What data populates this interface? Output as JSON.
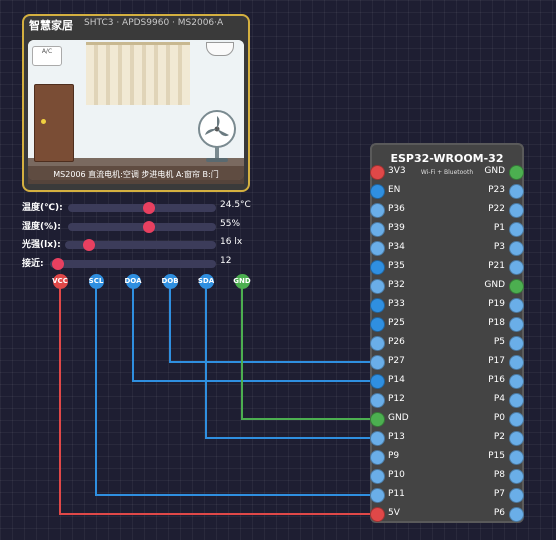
{
  "home_module": {
    "title": "智慧家居",
    "subtitle": "SHTC3 · APDS9960 · MS2006·A",
    "ac_label": "A/C",
    "status_text": "MS2006 直流电机:空调 步进电机 A:窗帘 B:门"
  },
  "sliders": [
    {
      "label": "温度(℃):",
      "value_text": "24.5°C",
      "fraction": 0.55
    },
    {
      "label": "湿度(%):",
      "value_text": "55%",
      "fraction": 0.55
    },
    {
      "label": "光强(lx):",
      "value_text": "16 lx",
      "fraction": 0.16
    },
    {
      "label": "接近:",
      "value_text": "12",
      "fraction": 0.05
    }
  ],
  "module_pins": [
    {
      "label": "VCC",
      "color": "#e04848"
    },
    {
      "label": "SCL",
      "color": "#2f8fe0"
    },
    {
      "label": "DOA",
      "color": "#2f8fe0"
    },
    {
      "label": "DOB",
      "color": "#2f8fe0"
    },
    {
      "label": "SDA",
      "color": "#2f8fe0"
    },
    {
      "label": "GND",
      "color": "#4caf50"
    }
  ],
  "esp32": {
    "title": "ESP32-WROOM-32",
    "subtitle": "Wi-Fi + Bluetooth",
    "left_pins": [
      {
        "label": "3V3",
        "color": "#e04848"
      },
      {
        "label": "EN",
        "color": "#2f8fe0"
      },
      {
        "label": "P36",
        "color": "#6aaee8"
      },
      {
        "label": "P39",
        "color": "#6aaee8"
      },
      {
        "label": "P34",
        "color": "#6aaee8"
      },
      {
        "label": "P35",
        "color": "#2f8fe0"
      },
      {
        "label": "P32",
        "color": "#6aaee8"
      },
      {
        "label": "P33",
        "color": "#2f8fe0"
      },
      {
        "label": "P25",
        "color": "#2f8fe0"
      },
      {
        "label": "P26",
        "color": "#6aaee8"
      },
      {
        "label": "P27",
        "color": "#6aaee8"
      },
      {
        "label": "P14",
        "color": "#2f8fe0"
      },
      {
        "label": "P12",
        "color": "#6aaee8"
      },
      {
        "label": "GND",
        "color": "#4caf50"
      },
      {
        "label": "P13",
        "color": "#6aaee8"
      },
      {
        "label": "P9",
        "color": "#6aaee8"
      },
      {
        "label": "P10",
        "color": "#6aaee8"
      },
      {
        "label": "P11",
        "color": "#6aaee8"
      },
      {
        "label": "5V",
        "color": "#e04848"
      }
    ],
    "right_pins": [
      {
        "label": "GND",
        "color": "#4caf50"
      },
      {
        "label": "P23",
        "color": "#6aaee8"
      },
      {
        "label": "P22",
        "color": "#6aaee8"
      },
      {
        "label": "P1",
        "color": "#6aaee8"
      },
      {
        "label": "P3",
        "color": "#6aaee8"
      },
      {
        "label": "P21",
        "color": "#6aaee8"
      },
      {
        "label": "GND",
        "color": "#4caf50"
      },
      {
        "label": "P19",
        "color": "#6aaee8"
      },
      {
        "label": "P18",
        "color": "#6aaee8"
      },
      {
        "label": "P5",
        "color": "#6aaee8"
      },
      {
        "label": "P17",
        "color": "#6aaee8"
      },
      {
        "label": "P16",
        "color": "#6aaee8"
      },
      {
        "label": "P4",
        "color": "#6aaee8"
      },
      {
        "label": "P0",
        "color": "#6aaee8"
      },
      {
        "label": "P2",
        "color": "#6aaee8"
      },
      {
        "label": "P15",
        "color": "#6aaee8"
      },
      {
        "label": "P8",
        "color": "#6aaee8"
      },
      {
        "label": "P7",
        "color": "#6aaee8"
      },
      {
        "label": "P6",
        "color": "#6aaee8"
      }
    ]
  }
}
